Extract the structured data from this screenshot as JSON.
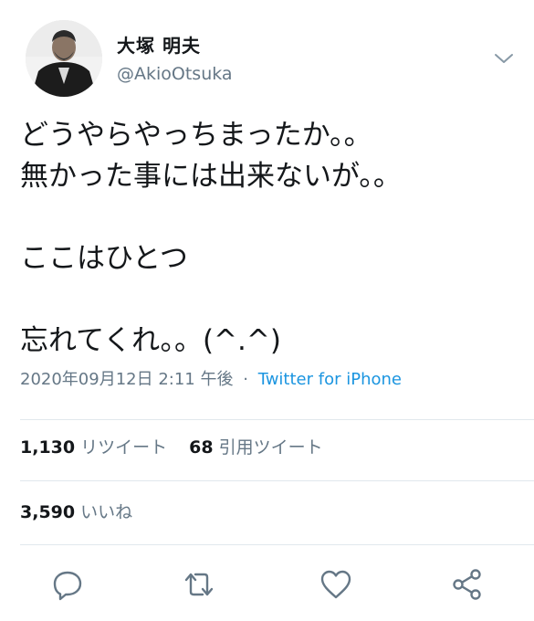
{
  "author": {
    "name": "大塚 明夫",
    "handle": "@AkioOtsuka",
    "avatar_icon": "profile-photo",
    "menu_icon": "chevron-down-icon"
  },
  "tweet": {
    "lines": [
      "どうやらやっちまったか。。",
      "無かった事には出来ないが。。",
      "",
      "ここはひとつ",
      "",
      "忘れてくれ。。(^.^)"
    ],
    "timestamp": "2020年09月12日 2:11 午後",
    "separator": "·",
    "source": "Twitter for iPhone"
  },
  "stats": {
    "retweets_count": "1,130",
    "retweets_label": "リツイート",
    "quotes_count": "68",
    "quotes_label": "引用ツイート",
    "likes_count": "3,590",
    "likes_label": "いいね"
  },
  "actions": {
    "reply_icon": "reply-icon",
    "retweet_icon": "retweet-icon",
    "like_icon": "heart-icon",
    "share_icon": "share-icon"
  },
  "colors": {
    "text": "#14171a",
    "muted": "#657786",
    "link": "#1b95e0",
    "divider": "#e1e8ed"
  }
}
